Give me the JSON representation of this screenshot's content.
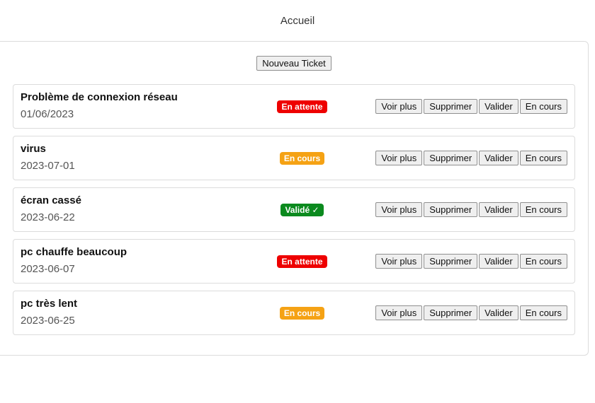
{
  "header": {
    "title": "Accueil"
  },
  "toolbar": {
    "new_ticket_label": "Nouveau Ticket"
  },
  "actions": {
    "view_more": "Voir plus",
    "delete": "Supprimer",
    "validate": "Valider",
    "in_progress": "En cours"
  },
  "status_colors": {
    "waiting": "#ee0000",
    "progress": "#f5a214",
    "validated": "#0b8a1e"
  },
  "tickets": [
    {
      "title": "Problème de connexion réseau",
      "date": "01/06/2023",
      "status": "En attente",
      "status_type": "waiting"
    },
    {
      "title": "virus",
      "date": "2023-07-01",
      "status": "En cours",
      "status_type": "progress"
    },
    {
      "title": "écran cassé",
      "date": "2023-06-22",
      "status": "Validé ✓",
      "status_type": "validated"
    },
    {
      "title": "pc chauffe beaucoup",
      "date": "2023-06-07",
      "status": "En attente",
      "status_type": "waiting"
    },
    {
      "title": "pc très lent",
      "date": "2023-06-25",
      "status": "En cours",
      "status_type": "progress"
    }
  ]
}
